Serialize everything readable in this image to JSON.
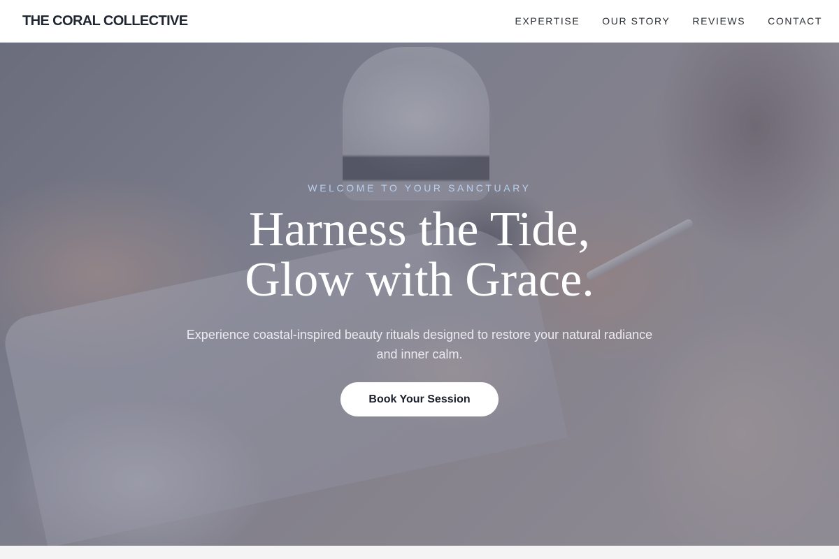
{
  "nav": {
    "brand": "THE CORAL COLLECTIVE",
    "links": [
      "EXPERTISE",
      "OUR STORY",
      "REVIEWS",
      "CONTACT"
    ]
  },
  "hero": {
    "eyebrow": "WELCOME TO YOUR SANCTUARY",
    "headline_line1": "Harness the Tide,",
    "headline_line2": "Glow with Grace.",
    "subtext": "Experience coastal-inspired beauty rituals designed to restore your natural radiance and inner calm.",
    "cta_label": "Book Your Session",
    "background_image": "manicure-session-photo"
  },
  "colors": {
    "eyebrow": "#b8d0f0",
    "brand_text": "#1f2630",
    "cta_bg": "#ffffff",
    "cta_text": "#1a1f2a"
  }
}
